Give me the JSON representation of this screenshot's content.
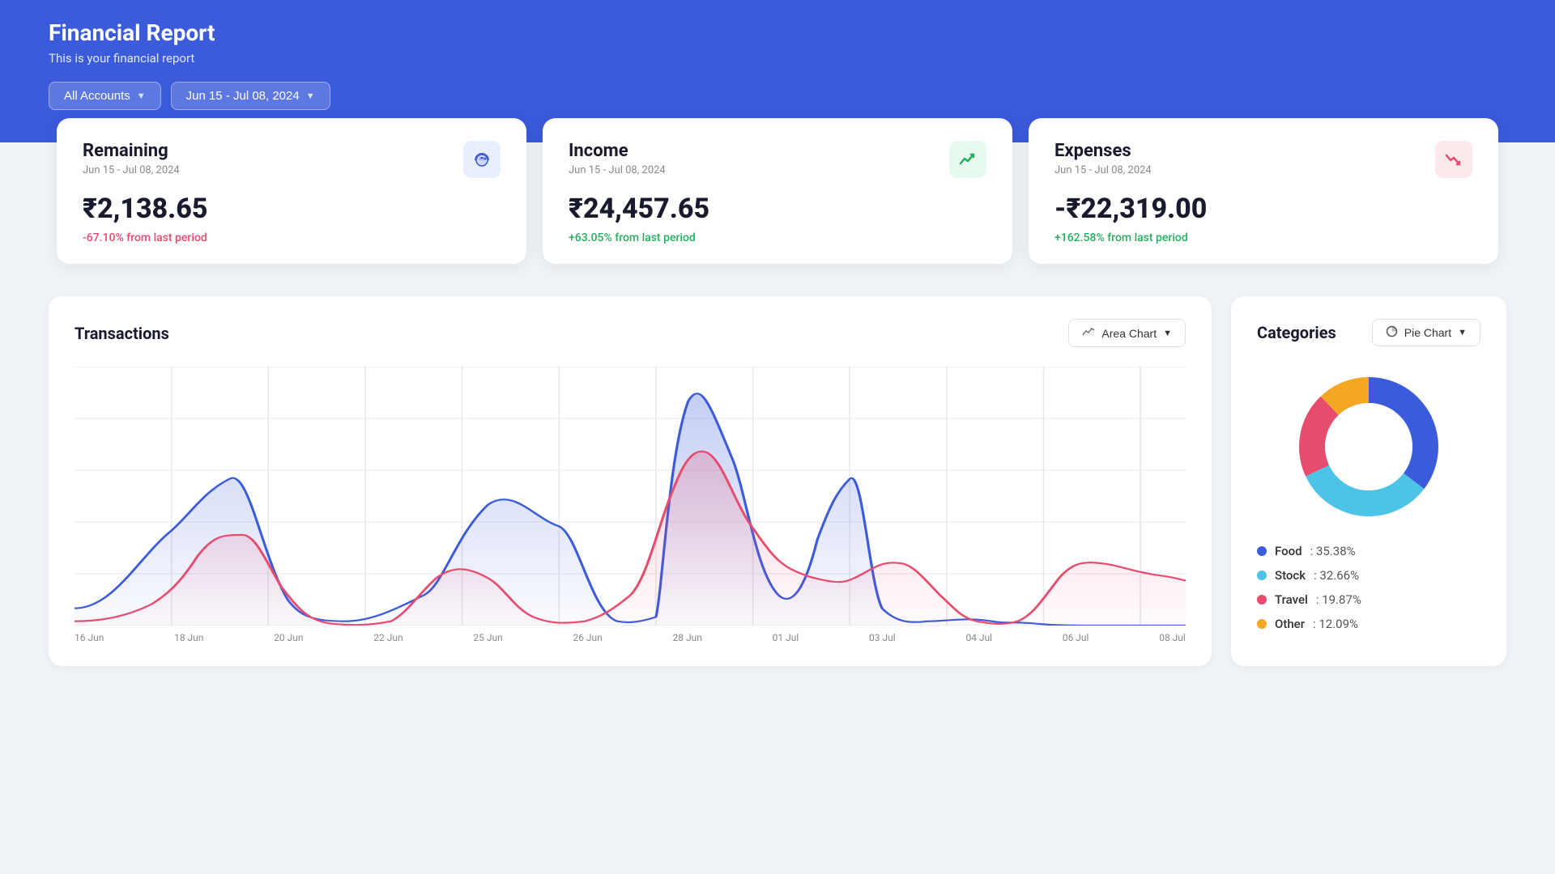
{
  "header": {
    "title": "Financial Report",
    "subtitle": "This is your financial report",
    "accounts_label": "All Accounts",
    "date_range_label": "Jun 15 - Jul 08, 2024"
  },
  "cards": [
    {
      "id": "remaining",
      "title": "Remaining",
      "date": "Jun 15 - Jul 08, 2024",
      "amount": "₹2,138.65",
      "change": "-67.10% from last period",
      "change_type": "negative",
      "icon": "🐷",
      "icon_class": "blue"
    },
    {
      "id": "income",
      "title": "Income",
      "date": "Jun 15 - Jul 08, 2024",
      "amount": "₹24,457.65",
      "change": "+63.05% from last period",
      "change_type": "positive",
      "icon": "📈",
      "icon_class": "green"
    },
    {
      "id": "expenses",
      "title": "Expenses",
      "date": "Jun 15 - Jul 08, 2024",
      "amount": "-₹22,319.00",
      "change": "+162.58% from last period",
      "change_type": "positive",
      "icon": "📉",
      "icon_class": "pink"
    }
  ],
  "transactions": {
    "title": "Transactions",
    "chart_type": "Area Chart",
    "x_labels": [
      "16 Jun",
      "18 Jun",
      "20 Jun",
      "22 Jun",
      "25 Jun",
      "26 Jun",
      "28 Jun",
      "01 Jul",
      "03 Jul",
      "04 Jul",
      "06 Jul",
      "08 Jul"
    ]
  },
  "categories": {
    "title": "Categories",
    "chart_type": "Pie Chart",
    "items": [
      {
        "label": "Food",
        "pct": 35.38,
        "color": "#3b5bdb",
        "dot_color": "#3b5bdb"
      },
      {
        "label": "Stock",
        "pct": 32.66,
        "color": "#4dc3e8",
        "dot_color": "#4dc3e8"
      },
      {
        "label": "Travel",
        "pct": 19.87,
        "color": "#e74c6e",
        "dot_color": "#e74c6e"
      },
      {
        "label": "Other",
        "pct": 12.09,
        "color": "#f5a623",
        "dot_color": "#f5a623"
      }
    ]
  }
}
